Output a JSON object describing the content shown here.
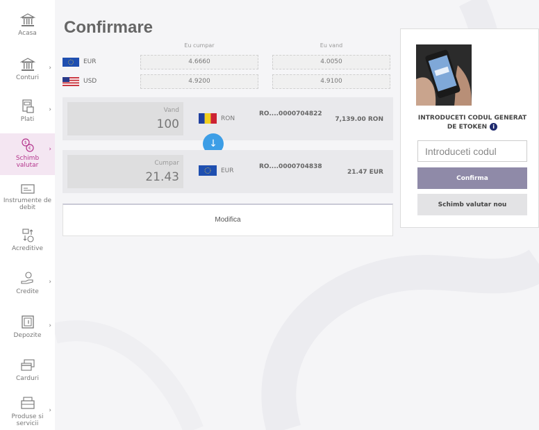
{
  "sidebar": {
    "items": [
      {
        "label": "Acasa",
        "icon": "bank-icon",
        "chevron": ""
      },
      {
        "label": "Conturi",
        "icon": "bank-icon",
        "chevron": "›"
      },
      {
        "label": "Plati",
        "icon": "payments-icon",
        "chevron": "›"
      },
      {
        "label": "Schimb valutar",
        "icon": "currency-exchange-icon",
        "chevron": "›"
      },
      {
        "label": "Instrumente de debit",
        "icon": "debit-instrument-icon",
        "chevron": ""
      },
      {
        "label": "Acreditive",
        "icon": "letter-of-credit-icon",
        "chevron": ""
      },
      {
        "label": "Credite",
        "icon": "loan-hand-icon",
        "chevron": "›"
      },
      {
        "label": "Depozite",
        "icon": "deposit-safe-icon",
        "chevron": "›"
      },
      {
        "label": "Carduri",
        "icon": "cards-icon",
        "chevron": ""
      },
      {
        "label": "Produse si servicii",
        "icon": "products-register-icon",
        "chevron": "›"
      }
    ],
    "active_color": "#b4348c"
  },
  "main": {
    "title": "Confirmare",
    "rates": {
      "buy_header": "Eu cumpar",
      "sell_header": "Eu vand",
      "rows": [
        {
          "currency": "EUR",
          "buy": "4.6660",
          "sell": "4.0050"
        },
        {
          "currency": "USD",
          "buy": "4.9200",
          "sell": "4.9100"
        }
      ]
    },
    "sell": {
      "label": "Vand",
      "amount": "100",
      "currency": "RON",
      "account": "RO....0000704822",
      "balance": "7,139.00 RON"
    },
    "buy": {
      "label": "Cumpar",
      "amount": "21.43",
      "currency": "EUR",
      "account": "RO....0000704838",
      "balance": "21.47 EUR"
    },
    "swap_icon": "arrow-down-icon",
    "modify_label": "Modifica"
  },
  "etoken": {
    "title": "INTRODUCETI CODUL GENERAT DE ETOKEN",
    "info_icon": "info-icon",
    "code_placeholder": "Introduceti codul",
    "confirm_label": "Confirma",
    "new_exchange_label": "Schimb valutar nou"
  },
  "colors": {
    "accent_blue": "#3d9ee6",
    "confirm_purple": "#8f8aa8"
  }
}
